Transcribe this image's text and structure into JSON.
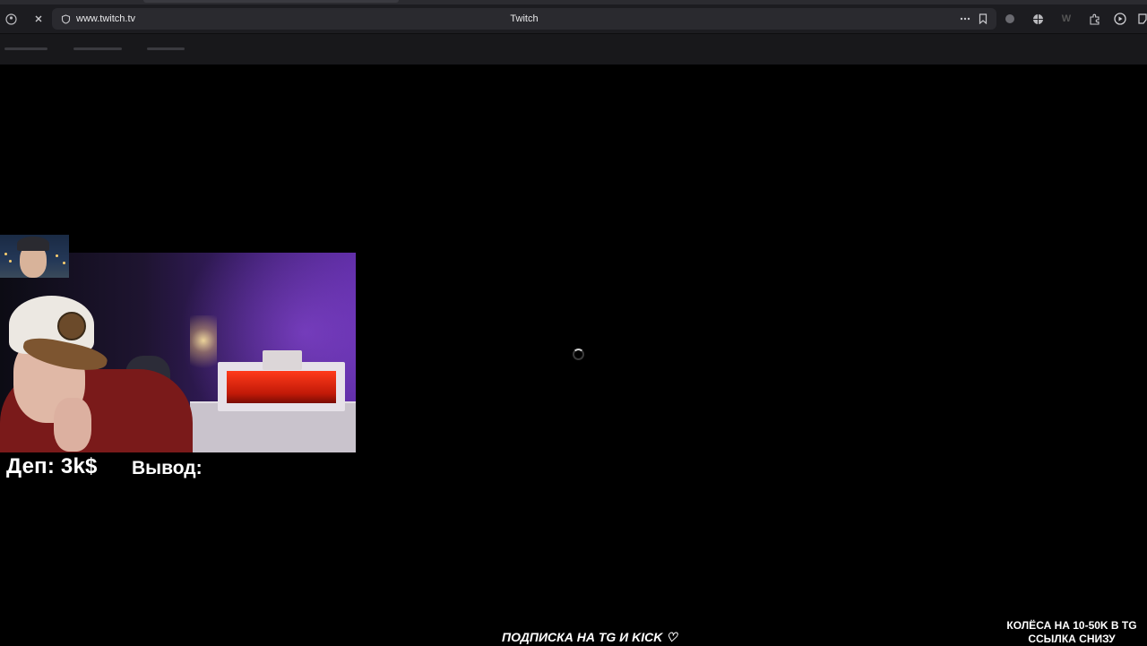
{
  "browser": {
    "url": "www.twitch.tv",
    "tab_title": "Twitch",
    "icons": [
      "shield-account-icon",
      "close-icon",
      "site-info-icon",
      "more-icon",
      "bookmark-icon",
      "extension-a-icon",
      "globe-icon",
      "w-icon",
      "puzzle-icon",
      "play-icon",
      "app-icon"
    ]
  },
  "page": {
    "loading": true
  },
  "overlay": {
    "deposit_label": "Деп: 3k$",
    "withdrawal_label": "Вывод:",
    "subscribe_promo": "ПОДПИСКА НА TG И KICK ♡",
    "wheel_promo_line1": "КОЛЁСА НА 10-50K В TG",
    "wheel_promo_line2": "ССЫЛКА СНИЗУ"
  },
  "colors": {
    "background": "#000000",
    "browser_bar": "#1c1c20",
    "accent_purple": "#5a2aa0"
  }
}
